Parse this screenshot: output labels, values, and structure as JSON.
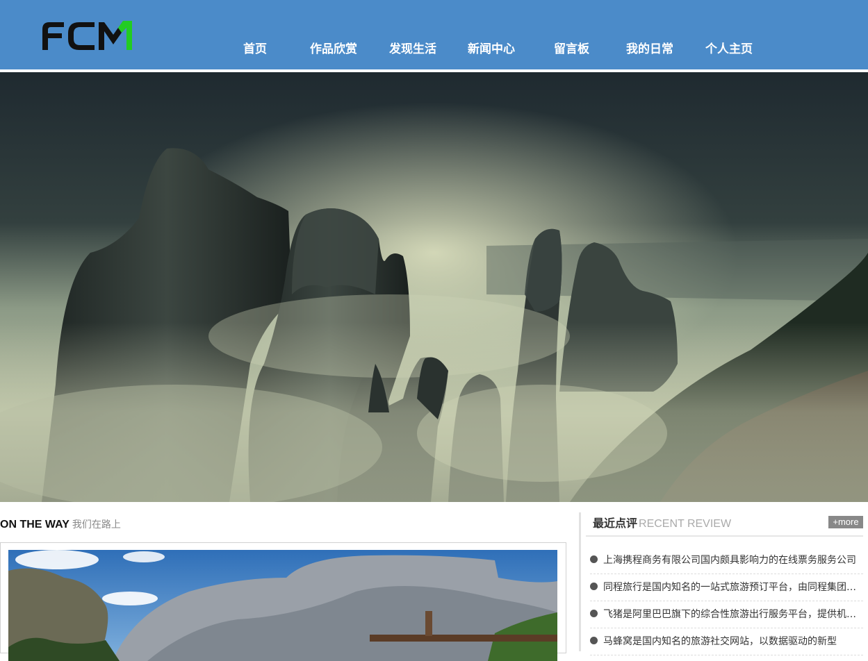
{
  "header": {
    "logo_text": "FCM",
    "colors": {
      "background": "#4b8bc9",
      "logo_dark": "#111111",
      "logo_accent": "#22cc22"
    }
  },
  "nav": {
    "items": [
      {
        "label": "首页"
      },
      {
        "label": "作品欣赏"
      },
      {
        "label": "发现生活"
      },
      {
        "label": "新闻中心"
      },
      {
        "label": "留言板"
      },
      {
        "label": "我的日常"
      },
      {
        "label": "个人主页"
      }
    ]
  },
  "hero": {
    "image": "misty-mountain-peaks"
  },
  "on_the_way": {
    "title_en": "ON THE WAY",
    "title_cn": "我们在路上",
    "image": "mountain-village-landscape"
  },
  "recent_review": {
    "title_cn": "最近点评",
    "title_en": "RECENT REVIEW",
    "more_label": "+more",
    "items": [
      {
        "text": "上海携程商务有限公司国内颇具影响力的在线票务服务公司"
      },
      {
        "text": "同程旅行是国内知名的一站式旅游预订平台，由同程集团运营"
      },
      {
        "text": "飞猪是阿里巴巴旗下的综合性旅游出行服务平台，提供机票酒店"
      },
      {
        "text": "马蜂窝是国内知名的旅游社交网站，以数据驱动的新型"
      }
    ]
  }
}
